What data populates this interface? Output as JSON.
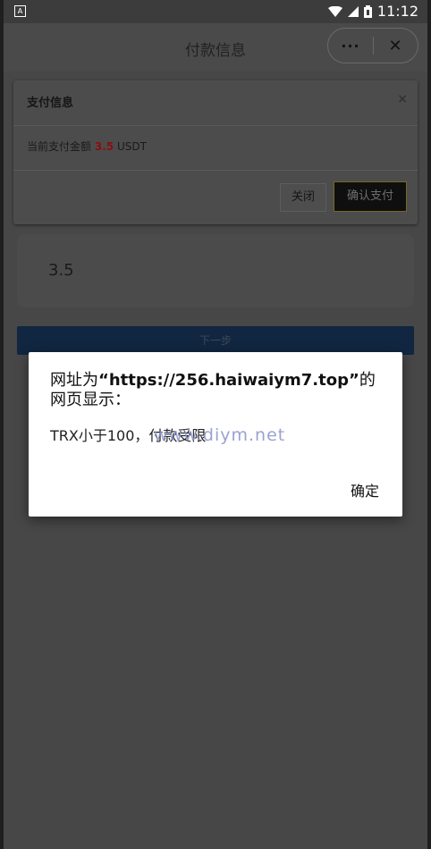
{
  "statusbar": {
    "left_icon": "A",
    "time": "11:12",
    "icons": [
      "wifi-icon",
      "signal-icon",
      "battery-icon"
    ]
  },
  "nav": {
    "title": "付款信息",
    "more_label": "···",
    "close_label": "✕"
  },
  "panel": {
    "title": "支付信息",
    "close_label": "×",
    "text_prefix": "当前支付金额",
    "amount": "3.5",
    "currency": "USDT",
    "btn_close": "关闭",
    "btn_confirm": "确认支付"
  },
  "amount_card": {
    "value": "3.5"
  },
  "next_button": {
    "label": "下一步"
  },
  "alert": {
    "title_prefix": "网址为",
    "url": "“https://256.haiwaiym7.top”",
    "title_suffix": "的网页显示：",
    "message": "TRX小于100，付款受限",
    "watermark": "www.diym.net",
    "ok_label": "确定"
  }
}
